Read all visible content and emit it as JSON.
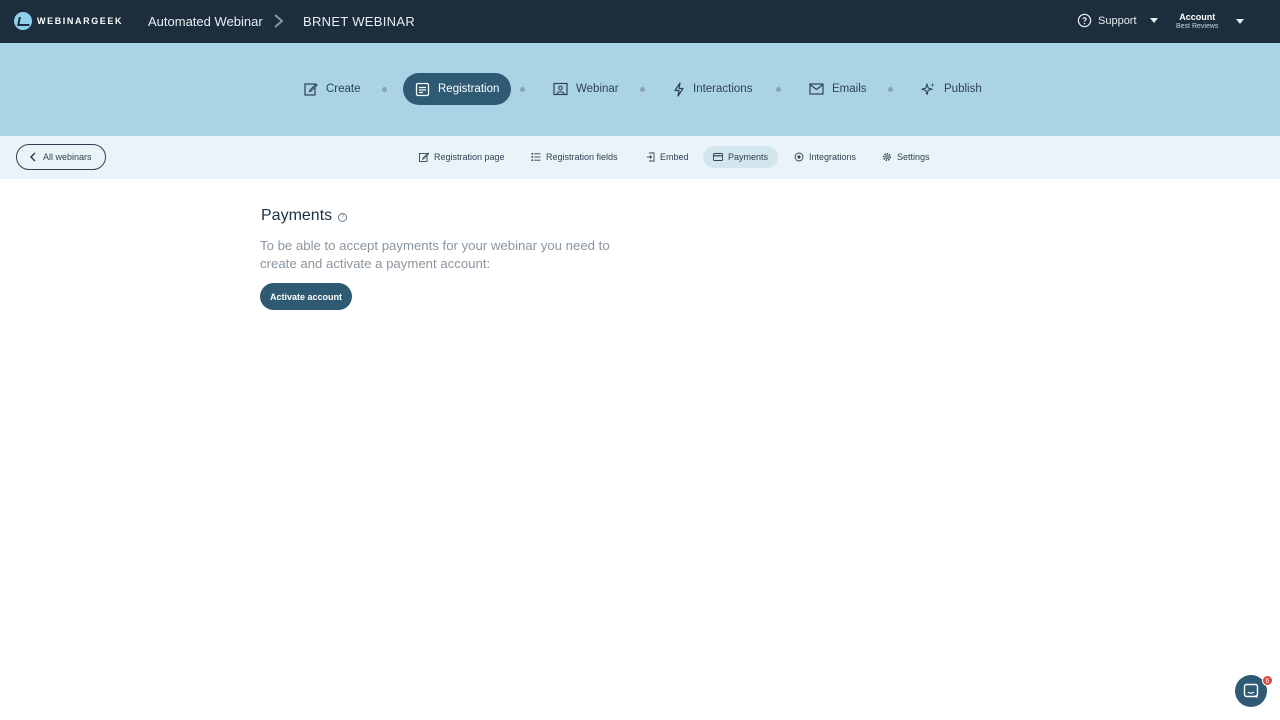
{
  "header": {
    "logo_text": "WEBINARGEEK",
    "breadcrumb": [
      "Automated Webinar",
      "BRNET WEBINAR"
    ],
    "support_label": "Support",
    "account_label": "Account",
    "account_sub": "Best Reviews"
  },
  "steps": [
    {
      "label": "Create",
      "icon": "edit-icon"
    },
    {
      "label": "Registration",
      "icon": "registration-icon",
      "active": true
    },
    {
      "label": "Webinar",
      "icon": "presentation-icon"
    },
    {
      "label": "Interactions",
      "icon": "lightning-icon"
    },
    {
      "label": "Emails",
      "icon": "envelope-icon"
    },
    {
      "label": "Publish",
      "icon": "sparkle-icon"
    }
  ],
  "subnav": {
    "back_label": "All webinars",
    "items": [
      {
        "label": "Registration page",
        "icon": "edit-icon"
      },
      {
        "label": "Registration fields",
        "icon": "list-icon"
      },
      {
        "label": "Embed",
        "icon": "embed-icon"
      },
      {
        "label": "Payments",
        "icon": "card-icon",
        "active": true
      },
      {
        "label": "Integrations",
        "icon": "integrations-icon"
      },
      {
        "label": "Settings",
        "icon": "gear-icon"
      }
    ]
  },
  "main": {
    "title": "Payments",
    "help": "?",
    "description": "To be able to accept payments for your webinar you need to create and activate a payment account:",
    "activate_label": "Activate account"
  },
  "chat": {
    "badge": "6"
  },
  "colors": {
    "topbar": "#1c2e3e",
    "steps_bg": "#aad4e6",
    "subnav_bg": "#eaf4f8",
    "accent": "#2e5a74",
    "badge": "#e0453a"
  }
}
